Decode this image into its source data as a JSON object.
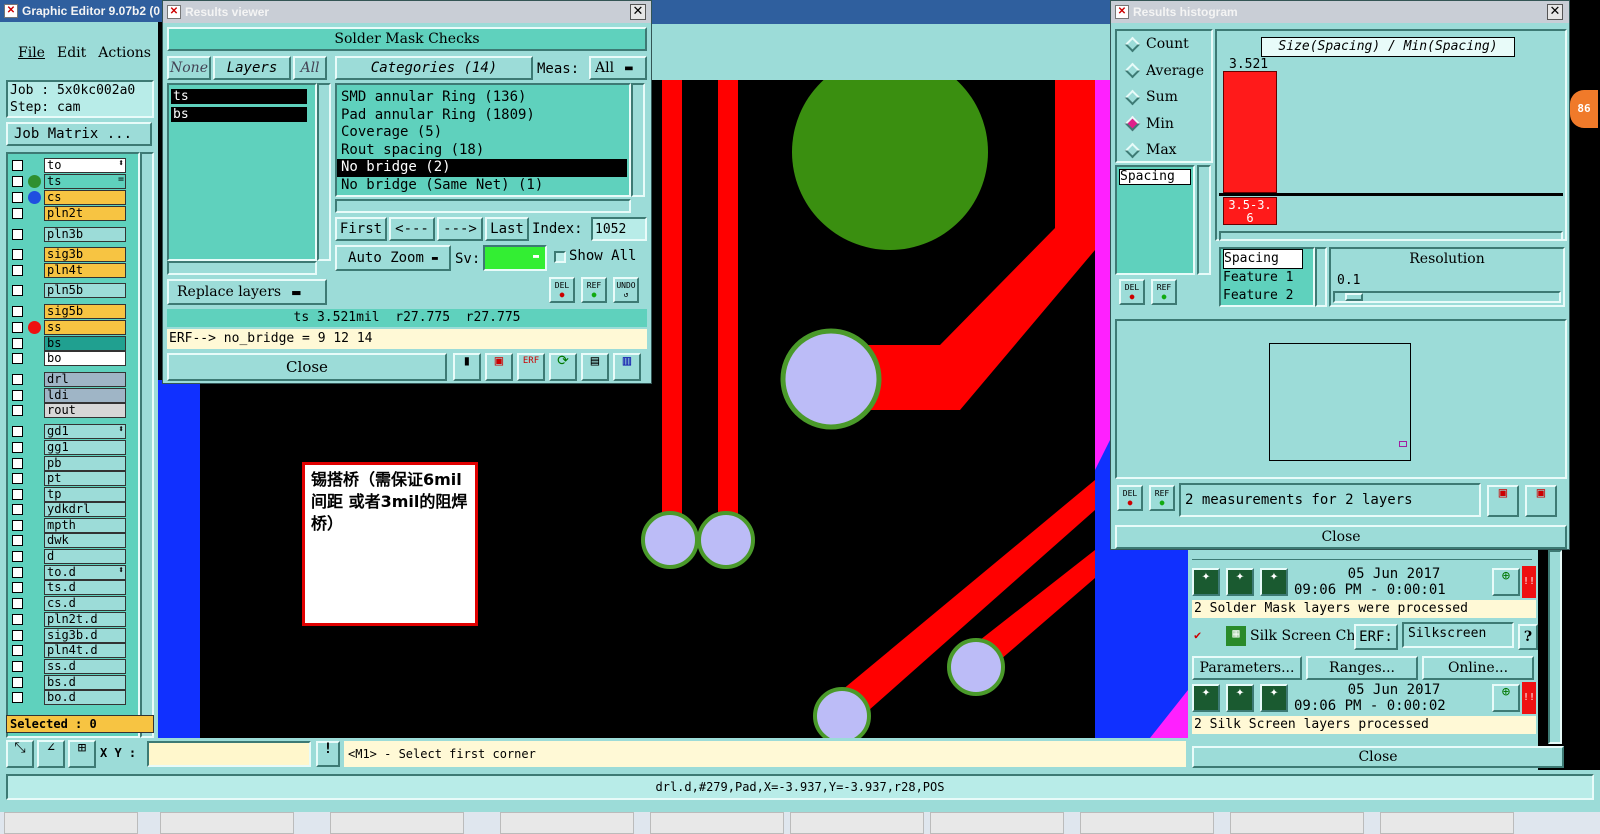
{
  "main_window": {
    "title": "Graphic Editor 9.07b2 (0",
    "menu": [
      "File",
      "Edit",
      "Actions"
    ],
    "job_label": "Job : 5x0kc002a0",
    "step_label": "Step: cam",
    "job_matrix_button": "Job Matrix ...",
    "selected_label": "Selected : 0",
    "xy_label": "X Y :",
    "xy_input_value": "",
    "prompt_text": "<M1> - Select first corner",
    "status_text": "drl.d,#279,Pad,X=-3.937,Y=-3.937,r28,POS"
  },
  "layers": [
    {
      "name": "to",
      "bg": "#ffffff",
      "dot": "",
      "mark": "⬍"
    },
    {
      "name": "ts",
      "bg": "#5fd1bd",
      "dot": "#2f8f2f",
      "mark": "="
    },
    {
      "name": "cs",
      "bg": "#f7c442",
      "dot": "#1f4fe0",
      "mark": ""
    },
    {
      "name": "pln2t",
      "bg": "#f7c442",
      "dot": "",
      "mark": ""
    },
    {
      "name": "pln3b",
      "bg": "#9cdcd8",
      "dot": "",
      "mark": ""
    },
    {
      "name": "sig3b",
      "bg": "#f7c442",
      "dot": "",
      "mark": ""
    },
    {
      "name": "pln4t",
      "bg": "#f7c442",
      "dot": "",
      "mark": ""
    },
    {
      "name": "pln5b",
      "bg": "#9cdcd8",
      "dot": "",
      "mark": ""
    },
    {
      "name": "sig5b",
      "bg": "#f7c442",
      "dot": "",
      "mark": ""
    },
    {
      "name": "ss",
      "bg": "#f7c442",
      "dot": "#ee1111",
      "mark": ""
    },
    {
      "name": "bs",
      "bg": "#20a090",
      "dot": "",
      "mark": ""
    },
    {
      "name": "bo",
      "bg": "#ffffff",
      "dot": "",
      "mark": ""
    },
    {
      "name": "drl",
      "bg": "#9fb5c6",
      "dot": "",
      "mark": ""
    },
    {
      "name": "ldi",
      "bg": "#9fb5c6",
      "dot": "",
      "mark": ""
    },
    {
      "name": "rout",
      "bg": "#d7d7d7",
      "dot": "",
      "mark": ""
    },
    {
      "name": "gd1",
      "bg": "#9cdcd8",
      "dot": "",
      "mark": "⬍"
    },
    {
      "name": "gg1",
      "bg": "#9cdcd8",
      "dot": "",
      "mark": ""
    },
    {
      "name": "pb",
      "bg": "#9cdcd8",
      "dot": "",
      "mark": ""
    },
    {
      "name": "pt",
      "bg": "#9cdcd8",
      "dot": "",
      "mark": ""
    },
    {
      "name": "tp",
      "bg": "#9cdcd8",
      "dot": "",
      "mark": ""
    },
    {
      "name": "ydkdrl",
      "bg": "#9cdcd8",
      "dot": "",
      "mark": ""
    },
    {
      "name": "mpth",
      "bg": "#9cdcd8",
      "dot": "",
      "mark": ""
    },
    {
      "name": "dwk",
      "bg": "#9cdcd8",
      "dot": "",
      "mark": ""
    },
    {
      "name": "d",
      "bg": "#9cdcd8",
      "dot": "",
      "mark": ""
    },
    {
      "name": "to.d",
      "bg": "#9cdcd8",
      "dot": "",
      "mark": "⬍"
    },
    {
      "name": "ts.d",
      "bg": "#9cdcd8",
      "dot": "",
      "mark": ""
    },
    {
      "name": "cs.d",
      "bg": "#9cdcd8",
      "dot": "",
      "mark": ""
    },
    {
      "name": "pln2t.d",
      "bg": "#9cdcd8",
      "dot": "",
      "mark": ""
    },
    {
      "name": "sig3b.d",
      "bg": "#9cdcd8",
      "dot": "",
      "mark": ""
    },
    {
      "name": "pln4t.d",
      "bg": "#9cdcd8",
      "dot": "",
      "mark": ""
    },
    {
      "name": "ss.d",
      "bg": "#9cdcd8",
      "dot": "",
      "mark": ""
    },
    {
      "name": "bs.d",
      "bg": "#9cdcd8",
      "dot": "",
      "mark": ""
    },
    {
      "name": "bo.d",
      "bg": "#9cdcd8",
      "dot": "",
      "mark": ""
    }
  ],
  "results_viewer": {
    "title": "Results viewer",
    "heading": "Solder Mask Checks",
    "none_btn": "None",
    "layers_btn": "Layers",
    "all_btn": "All",
    "categories_btn": "Categories (14)",
    "meas_label": "Meas:",
    "meas_value": "All",
    "layer_list": [
      "ts",
      "bs"
    ],
    "categories": [
      "SMD annular Ring (136)",
      "Pad annular Ring (1809)",
      "Coverage (5)",
      "Rout spacing (18)",
      "No bridge (2)",
      "No bridge (Same Net) (1)"
    ],
    "selected_category": 4,
    "first_btn": "First",
    "prev_btn": "<---",
    "next_btn": "--->",
    "last_btn": "Last",
    "index_label": "Index:",
    "index_value": "1052",
    "auto_zoom": "Auto Zoom",
    "sv_label": "Sv:",
    "show_all": "Show All",
    "replace_layers": "Replace layers",
    "measure_line": "ts 3.521mil  r27.775  r27.775",
    "erf_line": "ERF--> no_bridge = 9 12 14",
    "close_btn": "Close",
    "del_btn": "DEL",
    "ref_btn": "REF",
    "undo_btn": "UNDO"
  },
  "annotation": {
    "text": "锡搭桥（需保证6mil间距 或者3mil的阻焊桥）"
  },
  "histogram": {
    "title": "Results histogram",
    "stats": [
      "Count",
      "Average",
      "Sum",
      "Min",
      "Max"
    ],
    "selected_stat": 3,
    "chart_title": "Size(Spacing) / Min(Spacing)",
    "bar_value": "3.521",
    "bar_range": "3.5-3.6",
    "measure_list": [
      "Spacing"
    ],
    "feature_list": [
      "Spacing",
      "Feature 1",
      "Feature 2"
    ],
    "resolution_label": "Resolution",
    "resolution_value": "0.1",
    "summary": "2 measurements for 2 layers",
    "close_btn": "Close",
    "del_btn": "DEL",
    "ref_btn": "REF",
    "badge": "86"
  },
  "checklist": {
    "date1": "05 Jun 2017",
    "time1": "09:06 PM - 0:00:01",
    "msg1": "2 Solder Mask layers were processed",
    "silk_name": "Silk Screen Che",
    "erf_label": "ERF:",
    "erf_value": "Silkscreen",
    "help_btn": "?",
    "parameters_btn": "Parameters...",
    "ranges_btn": "Ranges...",
    "online_btn": "Online...",
    "date2": "05 Jun 2017",
    "time2": "09:06 PM - 0:00:02",
    "msg2": "2 Silk Screen layers processed",
    "close_btn": "Close",
    "warn": "!!"
  },
  "colors": {
    "panel": "#9cdcd8",
    "panel_dark": "#5fd1bd",
    "trace": "#ff0000",
    "pad_fill": "#bcbcf7",
    "pad_ring": "#4a9a2a",
    "green_pad": "#3a8f10",
    "canvas": "#000000",
    "blue_edge": "#1030ff",
    "magenta_edge": "#ff20ff",
    "bar": "#ff1a1a"
  }
}
